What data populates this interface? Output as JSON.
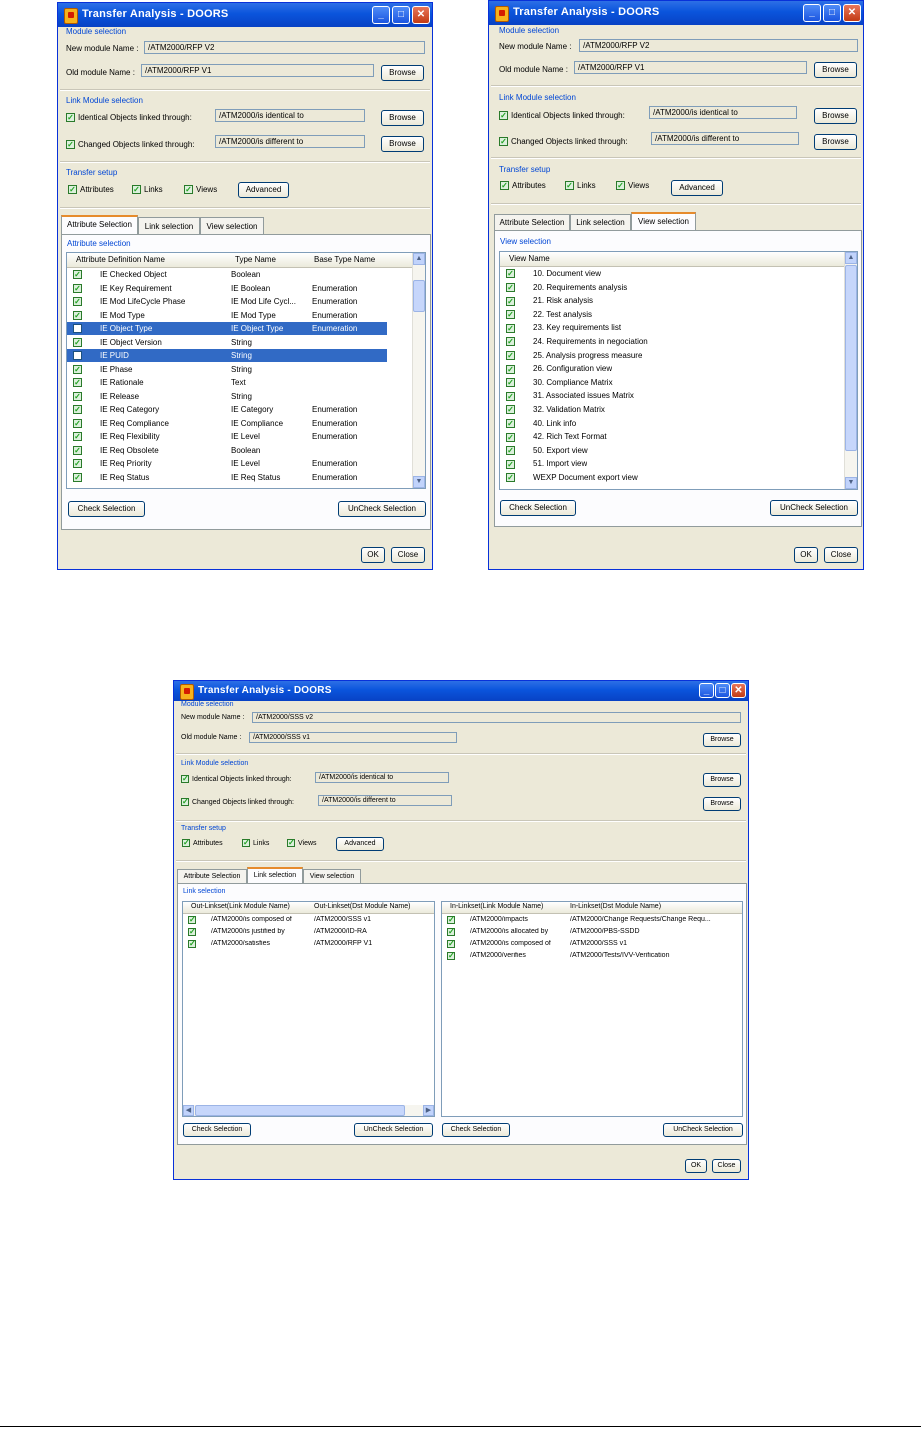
{
  "dialog_title": "Transfer Analysis - DOORS",
  "labels": {
    "module_selection": "Module selection",
    "new_module_name": "New module Name :",
    "old_module_name": "Old module Name :",
    "link_module_selection": "Link Module selection",
    "identical_objects": "Identical Objects linked through:",
    "changed_objects": "Changed Objects linked through:",
    "transfer_setup": "Transfer setup",
    "attributes": "Attributes",
    "links": "Links",
    "views": "Views",
    "attribute_selection": "Attribute selection",
    "view_selection": "View selection",
    "link_selection": "Link selection"
  },
  "buttons": {
    "browse": "Browse",
    "advanced": "Advanced",
    "check_selection": "Check Selection",
    "uncheck_selection": "UnCheck Selection",
    "ok": "OK",
    "close": "Close"
  },
  "tabs": {
    "attribute_selection": "Attribute Selection",
    "link_selection": "Link selection",
    "view_selection": "View selection"
  },
  "link_modules": {
    "identical": "/ATM2000/is identical to",
    "different": "/ATM2000/is different to"
  },
  "rfp": {
    "new_module": "/ATM2000/RFP V2",
    "old_module": "/ATM2000/RFP V1"
  },
  "sss": {
    "new_module": "/ATM2000/SSS v2",
    "old_module": "/ATM2000/SSS v1"
  },
  "attributes_table": {
    "headers": [
      "Attribute Definition Name",
      "Type Name",
      "Base Type Name"
    ],
    "rows": [
      {
        "name": "IE Checked Object",
        "type": "Boolean",
        "base": "",
        "checked": true,
        "selected": false
      },
      {
        "name": "IE Key Requirement",
        "type": "IE Boolean",
        "base": "Enumeration",
        "checked": true,
        "selected": false
      },
      {
        "name": "IE Mod LifeCycle Phase",
        "type": "IE Mod Life Cycl...",
        "base": "Enumeration",
        "checked": true,
        "selected": false
      },
      {
        "name": "IE Mod Type",
        "type": "IE Mod Type",
        "base": "Enumeration",
        "checked": true,
        "selected": false
      },
      {
        "name": "IE Object Type",
        "type": "IE Object Type",
        "base": "Enumeration",
        "checked": false,
        "selected": true
      },
      {
        "name": "IE Object Version",
        "type": "String",
        "base": "",
        "checked": true,
        "selected": false
      },
      {
        "name": "IE PUID",
        "type": "String",
        "base": "",
        "checked": false,
        "selected": true
      },
      {
        "name": "IE Phase",
        "type": "String",
        "base": "",
        "checked": true,
        "selected": false
      },
      {
        "name": "IE Rationale",
        "type": "Text",
        "base": "",
        "checked": true,
        "selected": false
      },
      {
        "name": "IE Release",
        "type": "String",
        "base": "",
        "checked": true,
        "selected": false
      },
      {
        "name": "IE Req Category",
        "type": "IE Category",
        "base": "Enumeration",
        "checked": true,
        "selected": false
      },
      {
        "name": "IE Req Compliance",
        "type": "IE Compliance",
        "base": "Enumeration",
        "checked": true,
        "selected": false
      },
      {
        "name": "IE Req Flexibility",
        "type": "IE Level",
        "base": "Enumeration",
        "checked": true,
        "selected": false
      },
      {
        "name": "IE Req Obsolete",
        "type": "Boolean",
        "base": "",
        "checked": true,
        "selected": false
      },
      {
        "name": "IE Req Priority",
        "type": "IE Level",
        "base": "Enumeration",
        "checked": true,
        "selected": false
      },
      {
        "name": "IE Req Status",
        "type": "IE Req Status",
        "base": "Enumeration",
        "checked": true,
        "selected": false
      }
    ]
  },
  "views_table": {
    "header": "View Name",
    "rows": [
      "10. Document view",
      "20. Requirements analysis",
      "21. Risk analysis",
      "22. Test analysis",
      "23. Key requirements list",
      "24. Requirements in negociation",
      "25. Analysis progress measure",
      "26. Configuration view",
      "30. Compliance Matrix",
      "31. Associated issues Matrix",
      "32. Validation Matrix",
      "40. Link info",
      "42. Rich Text Format",
      "50. Export view",
      "51. Import view",
      "WEXP Document export view"
    ]
  },
  "out_links": {
    "headers": [
      "Out-Linkset(Link Module Name)",
      "Out-Linkset(Dst Module Name)"
    ],
    "rows": [
      {
        "link": "/ATM2000/is composed of",
        "dst": "/ATM2000/SSS v1"
      },
      {
        "link": "/ATM2000/is justified by",
        "dst": "/ATM2000/ID-RA"
      },
      {
        "link": "/ATM2000/satisfies",
        "dst": "/ATM2000/RFP V1"
      }
    ]
  },
  "in_links": {
    "headers": [
      "In-Linkset(Link Module Name)",
      "In-Linkset(Dst Module Name)"
    ],
    "rows": [
      {
        "link": "/ATM2000/impacts",
        "dst": "/ATM2000/Change Requests/Change Requ..."
      },
      {
        "link": "/ATM2000/is allocated by",
        "dst": "/ATM2000/PBS-SSDD"
      },
      {
        "link": "/ATM2000/is composed of",
        "dst": "/ATM2000/SSS v1"
      },
      {
        "link": "/ATM2000/verifies",
        "dst": "/ATM2000/Tests/IVV-Verification"
      }
    ]
  }
}
